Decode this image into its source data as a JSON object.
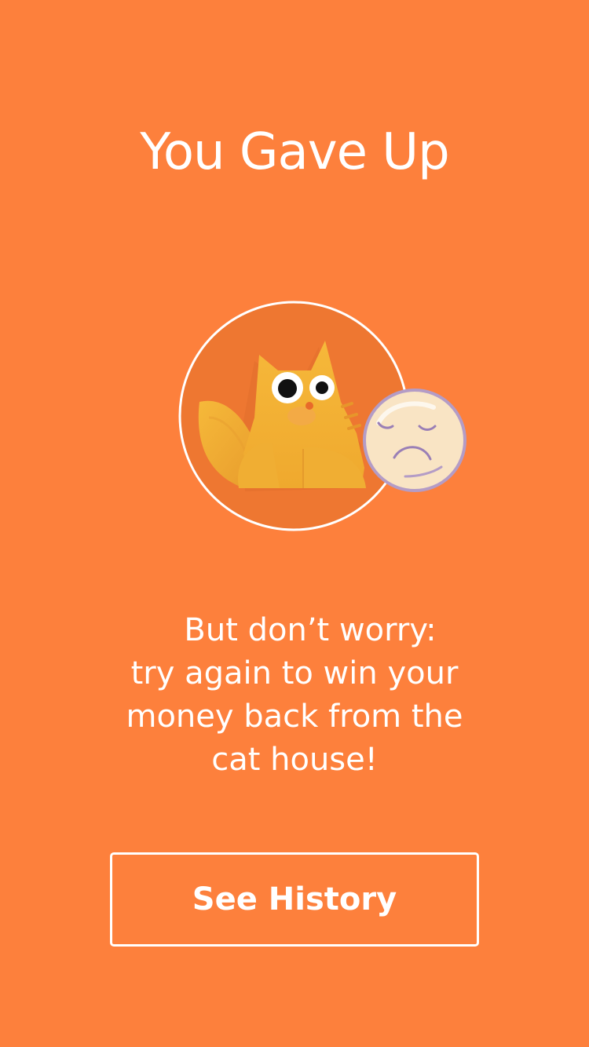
{
  "screen": {
    "title": "You Gave Up",
    "message_lines": [
      "But don’t worry:",
      "try again to win your",
      "money back from the",
      "cat house!"
    ],
    "history_button_label": "See History"
  },
  "icons": {
    "avatar": "orange-cat-illustration",
    "badge": "sad-face-icon"
  },
  "colors": {
    "background": "#FD803C",
    "avatar_circle": "#EE7731",
    "cat_body": "#F4B236",
    "face_badge": "#F9E4C4",
    "face_outline": "#B49CC6",
    "text": "#FFFFFF"
  }
}
